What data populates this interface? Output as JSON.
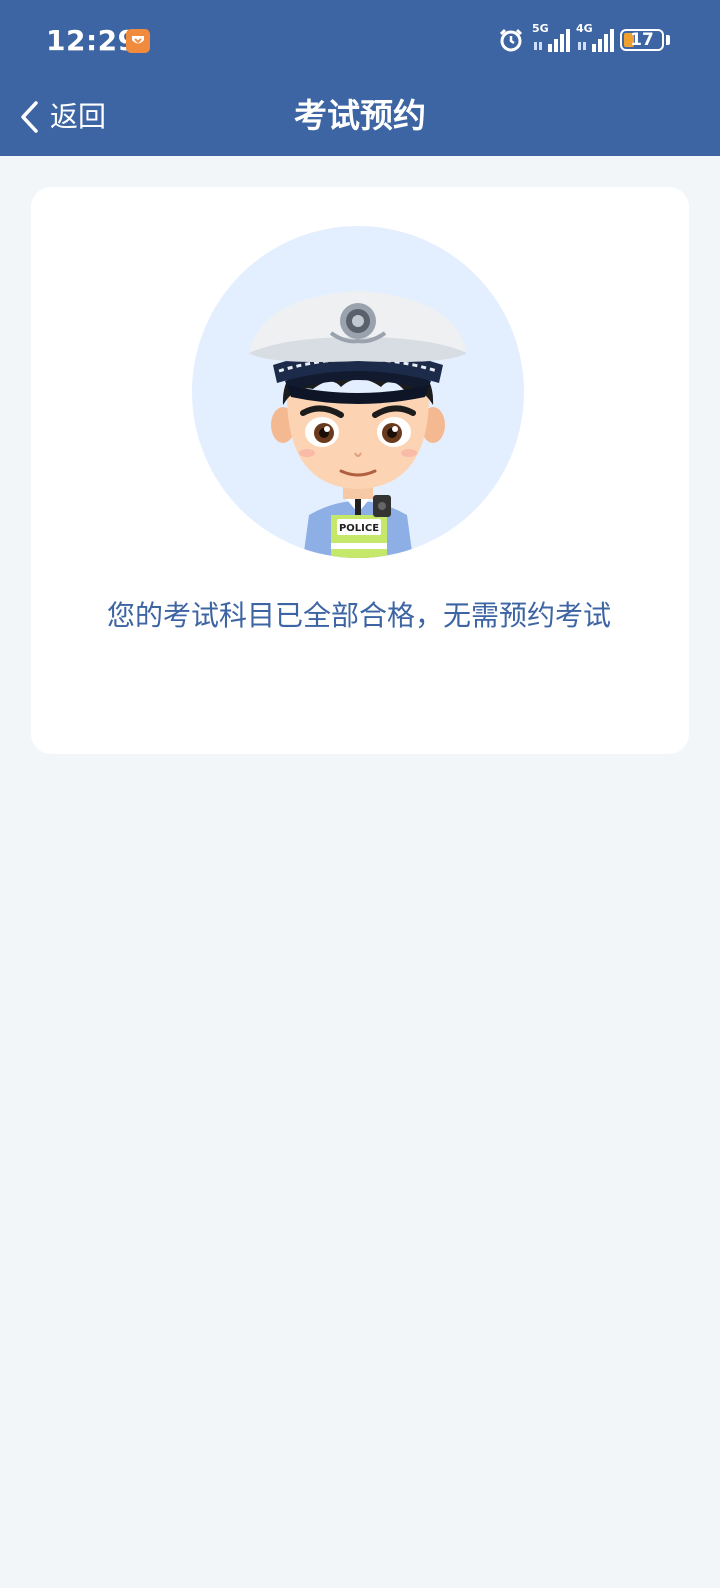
{
  "status_bar": {
    "time": "12:29",
    "network_5g": "5G",
    "network_4g": "4G",
    "battery_level": "17",
    "icons": [
      "app-badge-icon",
      "alarm-icon",
      "signal-5g-icon",
      "signal-4g-icon",
      "battery-icon"
    ]
  },
  "nav": {
    "back_label": "返回",
    "title": "考试预约"
  },
  "card": {
    "avatar": "police-officer-avatar",
    "message": "您的考试科目已全部合格，无需预约考试"
  },
  "colors": {
    "primary": "#3d64a3",
    "background": "#f2f6f9",
    "card": "#ffffff",
    "avatar_bg": "#e3efff",
    "battery_accent": "#f0a030"
  }
}
